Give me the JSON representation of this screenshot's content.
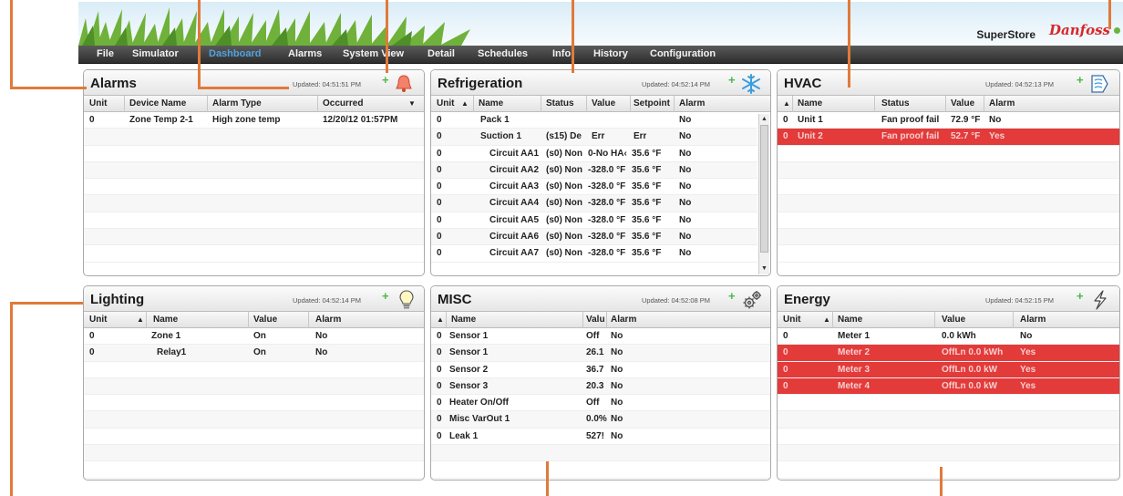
{
  "header": {
    "brand": "SuperStore",
    "logo": "Danfoss",
    "status_color": "#6cb33f"
  },
  "menu": [
    "File",
    "Simulator",
    "Dashboard",
    "Alarms",
    "System View",
    "Detail",
    "Schedules",
    "Info",
    "History",
    "Configuration"
  ],
  "colors": {
    "accent": "#e07a3a",
    "alarm_row": "#e33a3a",
    "active_menu": "#4fa3e0",
    "add_icon": "#4cb848"
  },
  "alarms": {
    "title": "Alarms",
    "updated": "Updated: 04:51:51 PM",
    "add": "+",
    "icon": "bell-icon",
    "columns": [
      "Unit",
      "Device Name",
      "Alarm Type",
      "Occurred"
    ],
    "rows": [
      [
        "0",
        "Zone Temp 2-1",
        "High zone temp",
        "12/20/12 01:57PM"
      ]
    ]
  },
  "refrigeration": {
    "title": "Refrigeration",
    "updated": "Updated: 04:52:14 PM",
    "add": "+",
    "icon": "snowflake-icon",
    "columns": [
      "Unit",
      "Name",
      "Status",
      "Value",
      "Setpoint",
      "Alarm"
    ],
    "rows": [
      [
        "0",
        "Pack 1",
        "",
        "",
        "",
        "No"
      ],
      [
        "0",
        "Suction 1",
        "(s15) De",
        "Err",
        "Err",
        "No"
      ],
      [
        "0",
        "Circuit AA1",
        "(s0) Non",
        "0-No HA‹",
        "35.6 °F",
        "No"
      ],
      [
        "0",
        "Circuit AA2",
        "(s0) Non",
        "-328.0 °F",
        "35.6 °F",
        "No"
      ],
      [
        "0",
        "Circuit AA3",
        "(s0) Non",
        "-328.0 °F",
        "35.6 °F",
        "No"
      ],
      [
        "0",
        "Circuit AA4",
        "(s0) Non",
        "-328.0 °F",
        "35.6 °F",
        "No"
      ],
      [
        "0",
        "Circuit AA5",
        "(s0) Non",
        "-328.0 °F",
        "35.6 °F",
        "No"
      ],
      [
        "0",
        "Circuit AA6",
        "(s0) Non",
        "-328.0 °F",
        "35.6 °F",
        "No"
      ],
      [
        "0",
        "Circuit AA7",
        "(s0) Non",
        "-328.0 °F",
        "35.6 °F",
        "No"
      ]
    ]
  },
  "hvac": {
    "title": "HVAC",
    "updated": "Updated: 04:52:13 PM",
    "add": "+",
    "icon": "airflow-icon",
    "columns": [
      "Name",
      "Status",
      "Value",
      "Alarm"
    ],
    "rows": [
      [
        "0",
        "Unit 1",
        "Fan proof fail",
        "72.9 °F",
        "No"
      ],
      [
        "0",
        "Unit 2",
        "Fan proof fail",
        "52.7 °F",
        "Yes"
      ]
    ]
  },
  "lighting": {
    "title": "Lighting",
    "updated": "Updated: 04:52:14 PM",
    "add": "+",
    "icon": "lightbulb-icon",
    "columns": [
      "Unit",
      "Name",
      "Value",
      "Alarm"
    ],
    "rows": [
      [
        "0",
        "Zone 1",
        "On",
        "No"
      ],
      [
        "0",
        "Relay1",
        "On",
        "No"
      ]
    ]
  },
  "misc": {
    "title": "MISC",
    "updated": "Updated: 04:52:08 PM",
    "add": "+",
    "icon": "gears-icon",
    "columns": [
      "Name",
      "Valu",
      "Alarm"
    ],
    "rows": [
      [
        "0",
        "Sensor 1",
        "Off",
        "No"
      ],
      [
        "0",
        "Sensor 1",
        "26.1",
        "No"
      ],
      [
        "0",
        "Sensor 2",
        "36.7",
        "No"
      ],
      [
        "0",
        "Sensor 3",
        "20.3",
        "No"
      ],
      [
        "0",
        "Heater On/Off",
        "Off",
        "No"
      ],
      [
        "0",
        "Misc VarOut 1",
        "0.0%",
        "No"
      ],
      [
        "0",
        "Leak 1",
        "527!",
        "No"
      ]
    ]
  },
  "energy": {
    "title": "Energy",
    "updated": "Updated: 04:52:15 PM",
    "add": "+",
    "icon": "lightning-icon",
    "columns": [
      "Unit",
      "Name",
      "Value",
      "Alarm"
    ],
    "rows": [
      [
        "0",
        "Meter 1",
        "0.0 kWh",
        "No"
      ],
      [
        "0",
        "Meter 2",
        "OffLn 0.0 kWh",
        "Yes"
      ],
      [
        "0",
        "Meter 3",
        "OffLn 0.0 kW",
        "Yes"
      ],
      [
        "0",
        "Meter 4",
        "OffLn 0.0 kW",
        "Yes"
      ]
    ]
  }
}
